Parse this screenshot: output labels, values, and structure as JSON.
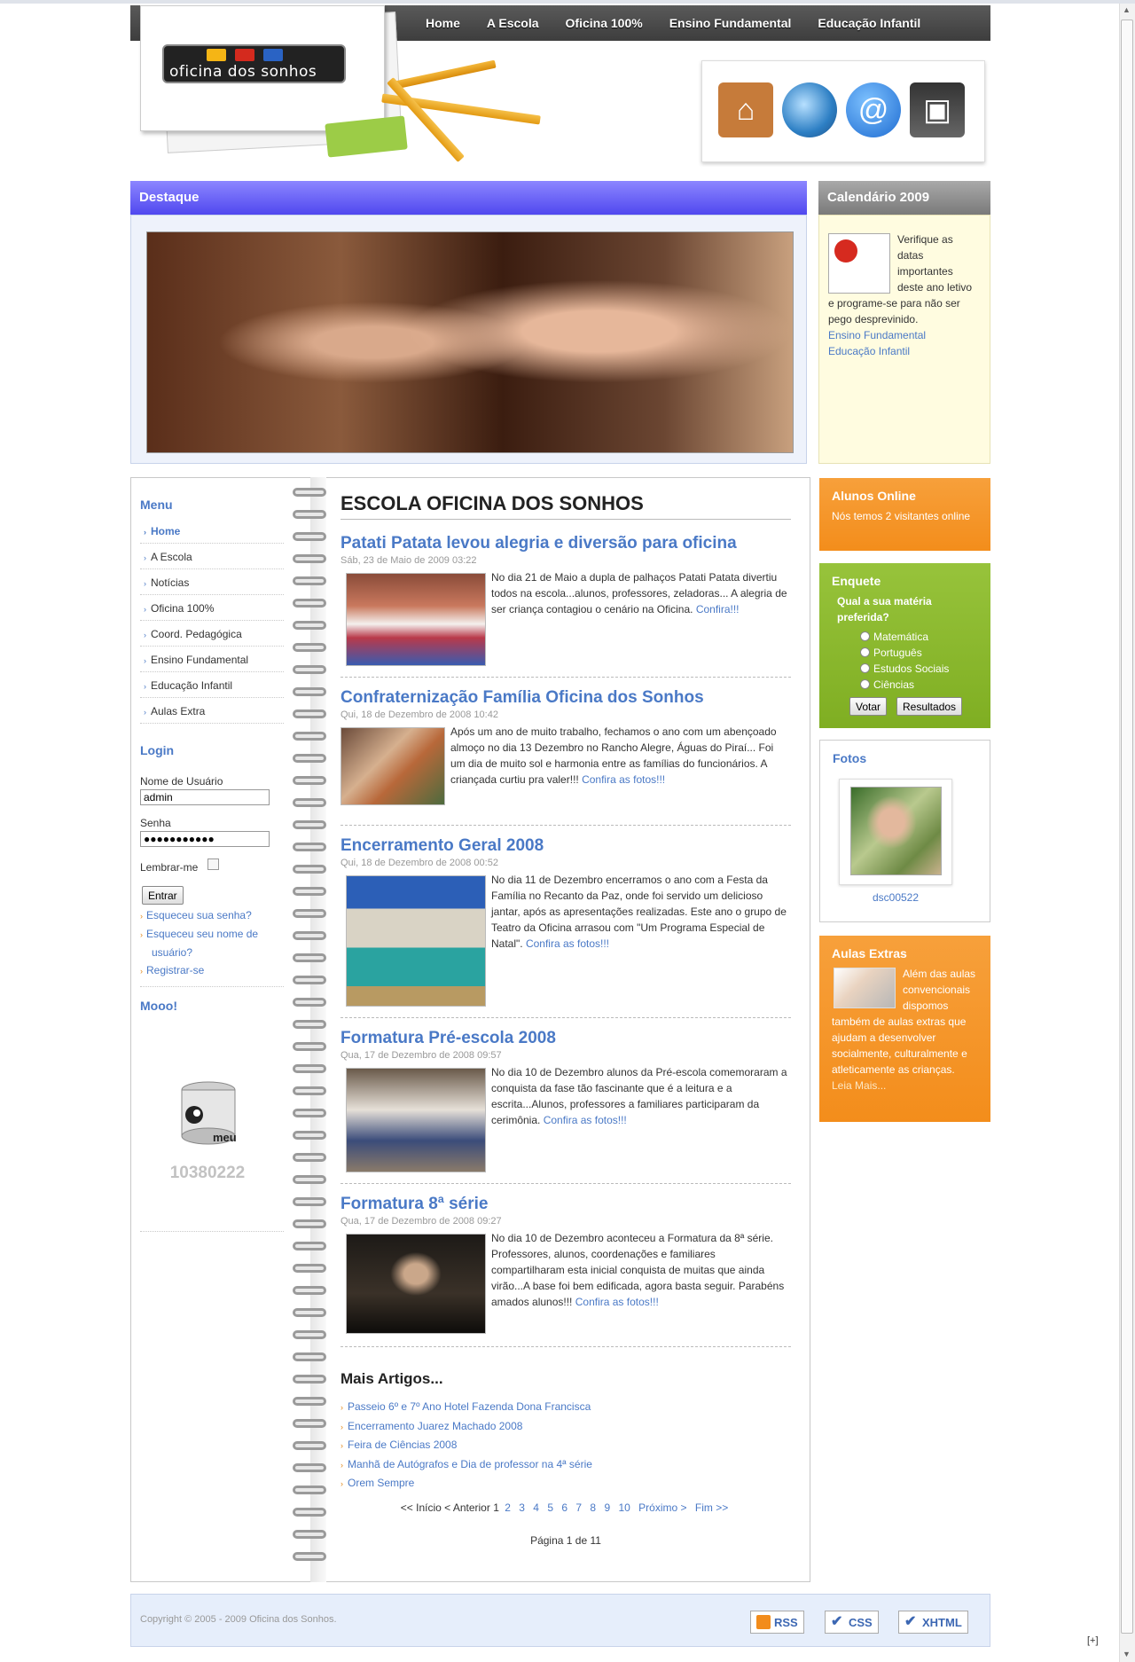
{
  "nav": [
    "Home",
    "A Escola",
    "Oficina 100%",
    "Ensino Fundamental",
    "Educação Infantil"
  ],
  "logo_text": "oficina dos sonhos",
  "destaque": {
    "title": "Destaque"
  },
  "calendario": {
    "title": "Calendário 2009",
    "text": "Verifique as datas importantes deste ano letivo e programe-se para não ser pego desprevinido.",
    "links": [
      "Ensino Fundamental",
      "Educação Infantil"
    ]
  },
  "menu": {
    "title": "Menu",
    "items": [
      "Home",
      "A Escola",
      "Notícias",
      "Oficina 100%",
      "Coord. Pedagógica",
      "Ensino Fundamental",
      "Educação Infantil",
      "Aulas Extra"
    ]
  },
  "login": {
    "title": "Login",
    "username_label": "Nome de Usuário",
    "username_value": "admin",
    "password_label": "Senha",
    "password_value": "●●●●●●●●●●●",
    "remember_label": "Lembrar-me",
    "submit": "Entrar",
    "links": [
      "Esqueceu sua senha?",
      "Esqueceu seu nome de usuário?",
      "Registrar-se"
    ]
  },
  "mooo": {
    "title": "Mooo!",
    "can_label": "meu",
    "count": "10380222"
  },
  "content": {
    "title": "ESCOLA OFICINA DOS SONHOS",
    "articles": [
      {
        "title": "Patati Patata levou alegria e diversão para oficina",
        "date": "Sáb, 23 de Maio de 2009 03:22",
        "text": "No dia 21 de Maio a dupla de palhaços Patati Patata divertiu todos na escola...alunos, professores, zeladoras... A alegria de ser criança contagiou o cenário na Oficina.",
        "link": "Confira!!!"
      },
      {
        "title": "Confraternização Família Oficina dos Sonhos",
        "date": "Qui, 18 de Dezembro de 2008 10:42",
        "text": "Após um  ano de muito trabalho, fechamos o ano com um abençoado almoço no dia 13 Dezembro no Rancho Alegre, Águas do Piraí... Foi um dia de muito sol e harmonia entre as famílias do funcionários. A criançada curtiu pra valer!!!",
        "link": "Confira as fotos!!!"
      },
      {
        "title": "Encerramento Geral 2008",
        "date": "Qui, 18 de Dezembro de 2008 00:52",
        "text": "No dia 11 de Dezembro encerramos o ano com  a Festa  da Família no Recanto da Paz, onde foi servido um delicioso jantar, após as apresentações realizadas. Este  ano o grupo de Teatro da Oficina  arrasou com \"Um Programa Especial de Natal\".",
        "link": "Confira as fotos!!!"
      },
      {
        "title": "Formatura Pré-escola 2008",
        "date": "Qua, 17 de Dezembro de 2008 09:57",
        "text": "No dia 10 de Dezembro alunos da Pré-escola comemoraram a conquista da fase tão fascinante que é a leitura e a escrita...Alunos, professores a familiares participaram da cerimônia.",
        "link": "Confira as fotos!!!"
      },
      {
        "title": "Formatura 8ª série",
        "date": "Qua, 17 de Dezembro de 2008 09:27",
        "text": "No dia 10 de Dezembro aconteceu a Formatura da 8ª série. Professores, alunos, coordenações e familiares compartilharam esta inicial conquista de muitas que ainda virão...A base foi bem edificada, agora basta seguir. Parabéns amados alunos!!!",
        "link": "Confira as fotos!!!"
      }
    ],
    "more_title": "Mais Artigos...",
    "more_links": [
      "Passeio 6º e 7º Ano Hotel Fazenda Dona Francisca",
      "Encerramento Juarez Machado 2008",
      "Feira de Ciências 2008",
      "Manhã de Autógrafos e Dia de professor na 4ª série",
      "Orem Sempre"
    ],
    "pager": {
      "start": "<< Início",
      "prev": "< Anterior",
      "current": "1",
      "pages": [
        "2",
        "3",
        "4",
        "5",
        "6",
        "7",
        "8",
        "9",
        "10"
      ],
      "next": "Próximo >",
      "end": "Fim >>",
      "label": "Página 1 de 11"
    }
  },
  "right": {
    "online": {
      "title": "Alunos Online",
      "text": "Nós temos 2 visitantes online"
    },
    "poll": {
      "title": "Enquete",
      "question": "Qual a sua matéria preferida?",
      "options": [
        "Matemática",
        "Português",
        "Estudos Sociais",
        "Ciências"
      ],
      "vote": "Votar",
      "results": "Resultados"
    },
    "fotos": {
      "title": "Fotos",
      "caption": "dsc00522"
    },
    "aulas": {
      "title": "Aulas Extras",
      "text": "Além das aulas convencionais dispomos também de aulas extras que ajudam a desenvolver socialmente, culturalmente e atleticamente as crianças.",
      "link": "Leia Mais..."
    }
  },
  "footer": {
    "copyright": "Copyright © 2005 - 2009 Oficina dos Sonhos.",
    "badges": [
      "RSS",
      "CSS",
      "XHTML"
    ],
    "expand": "[+]"
  },
  "colors": {
    "link": "#4a79c6",
    "orange": "#f38d1b",
    "green": "#7fae22",
    "purple": "#5048ef"
  }
}
